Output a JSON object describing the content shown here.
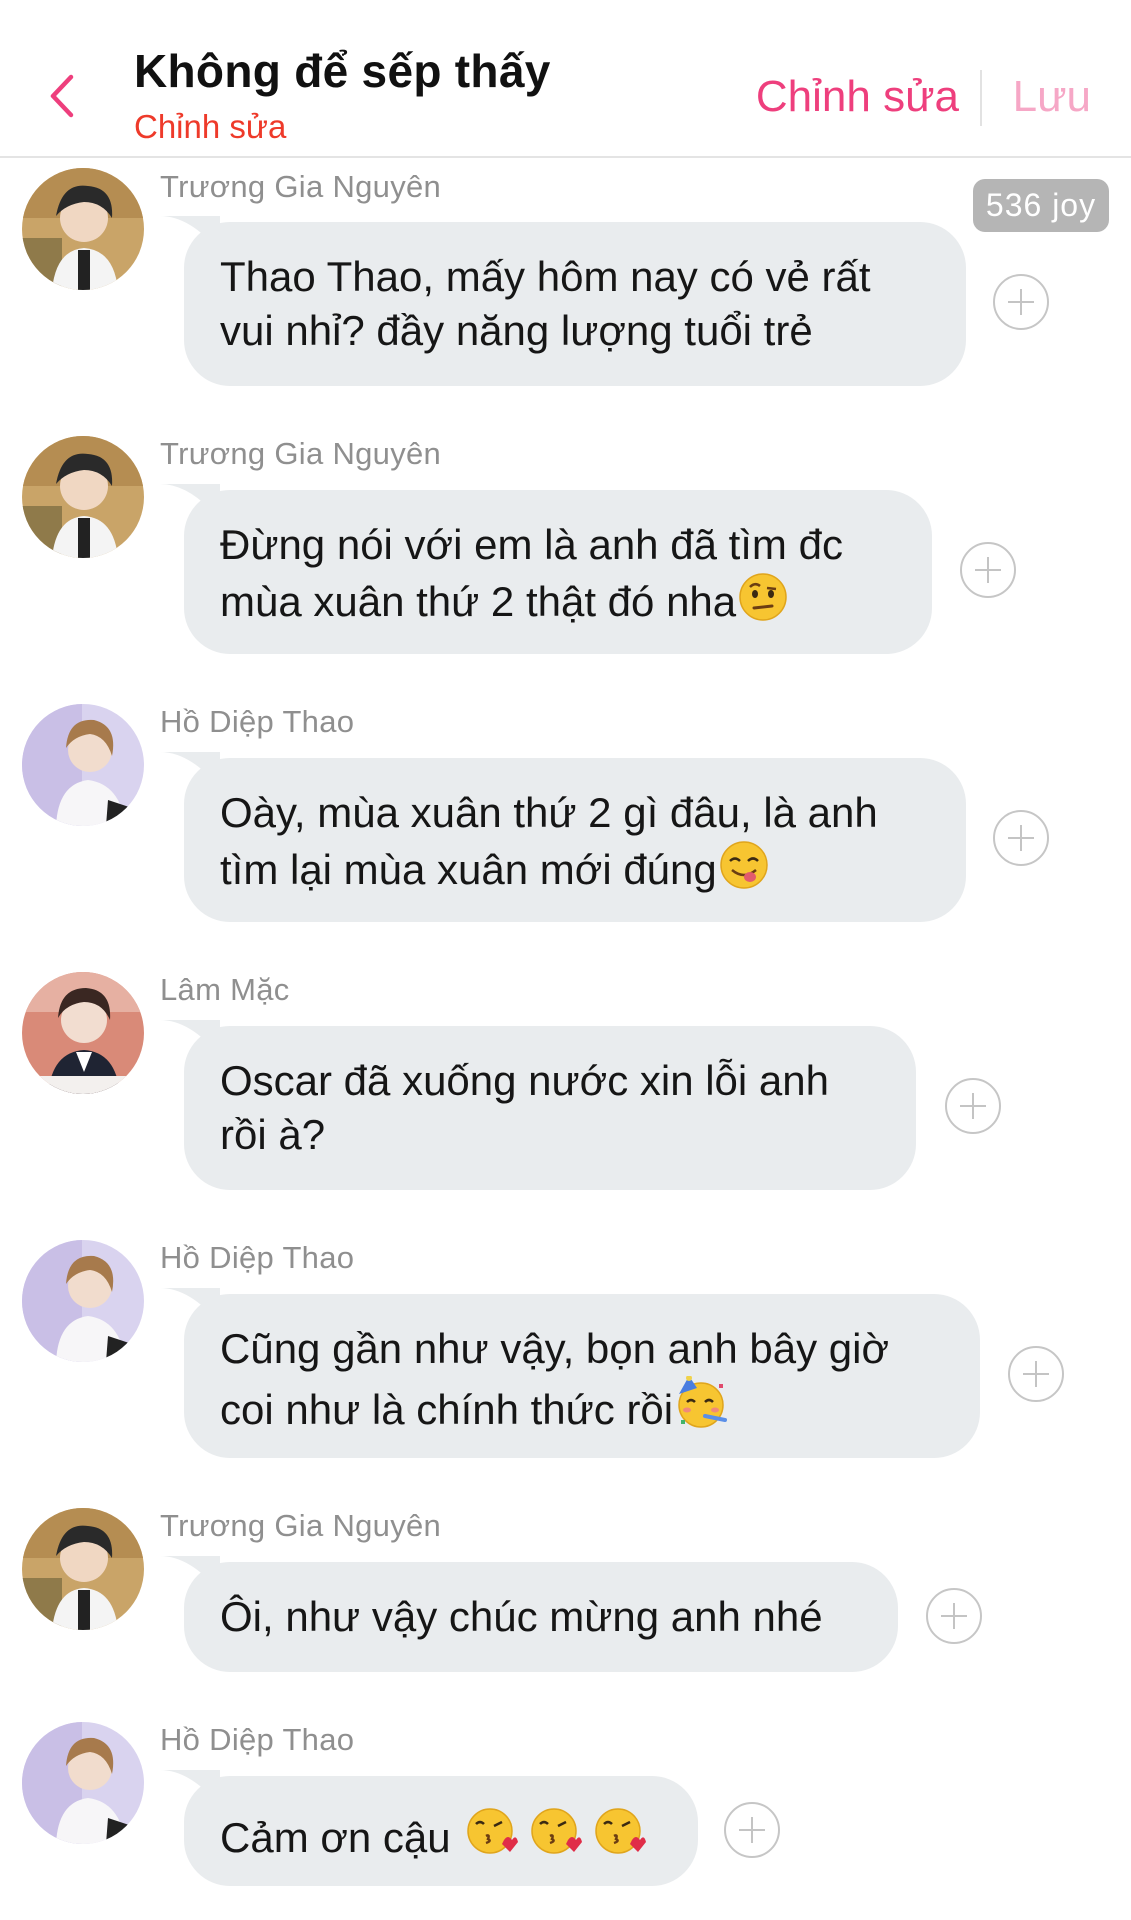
{
  "header": {
    "title": "Không để sếp thấy",
    "subtitle": "Chỉnh sửa",
    "edit_label": "Chỉnh sửa",
    "save_label": "Lưu"
  },
  "badge": {
    "text": "536 joy"
  },
  "messages": [
    {
      "sender": "Trương Gia Nguyên",
      "line1": "Thao Thao, mấy hôm nay có vẻ rất",
      "line2": "vui nhỉ? đầy năng lượng tuổi trẻ"
    },
    {
      "sender": "Trương Gia Nguyên",
      "line1": "Đừng nói với em là anh đã tìm đc",
      "line2": "mùa xuân thứ 2 thật đó nha",
      "emoji": "raised-eyebrow-emoji"
    },
    {
      "sender": "Hồ Diệp Thao",
      "line1": "Oày, mùa xuân thứ 2 gì đâu, là anh",
      "line2": "tìm lại mùa xuân mới đúng",
      "emoji": "yum-emoji"
    },
    {
      "sender": "Lâm Mặc",
      "line1": "Oscar đã xuống nước xin lỗi anh",
      "line2": "rồi à?"
    },
    {
      "sender": "Hồ Diệp Thao",
      "line1": "Cũng gần như vậy, bọn anh bây giờ",
      "line2": "coi như là chính thức rồi",
      "emoji": "party-face-emoji"
    },
    {
      "sender": "Trương Gia Nguyên",
      "line1": "Ôi, như vậy chúc mừng anh nhé"
    },
    {
      "sender": "Hồ Diệp Thao",
      "line1": "Cảm ơn cậu ",
      "emoji": "kissing-heart-emoji x3"
    }
  ],
  "colors": {
    "accent_pink": "#ee3f7d",
    "save_pink_disabled": "#f6a7c6",
    "subtitle_red": "#ee3a2a",
    "bubble_bg": "#e9ecee",
    "badge_bg": "#b5b5b5"
  }
}
